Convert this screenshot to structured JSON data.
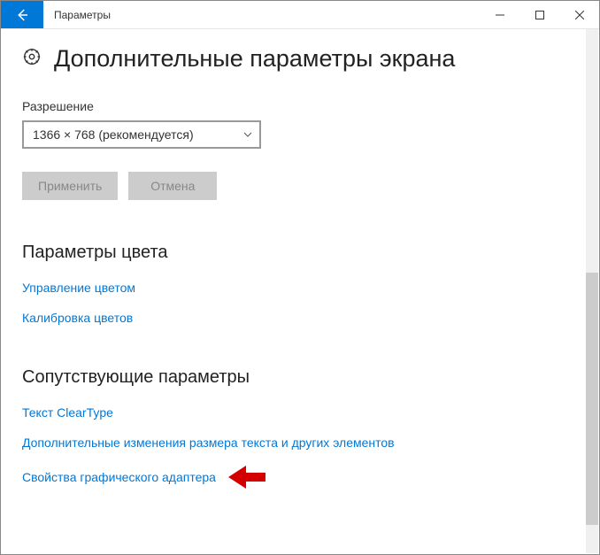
{
  "window": {
    "title": "Параметры"
  },
  "page": {
    "heading": "Дополнительные параметры экрана"
  },
  "resolution": {
    "label": "Разрешение",
    "value": "1366 × 768 (рекомендуется)"
  },
  "buttons": {
    "apply": "Применить",
    "cancel": "Отмена"
  },
  "colorSection": {
    "title": "Параметры цвета",
    "links": {
      "manage": "Управление цветом",
      "calibrate": "Калибровка цветов"
    }
  },
  "relatedSection": {
    "title": "Сопутствующие параметры",
    "links": {
      "cleartype": "Текст ClearType",
      "textsize": "Дополнительные изменения размера текста и других элементов",
      "adapter": "Свойства графического адаптера"
    }
  }
}
